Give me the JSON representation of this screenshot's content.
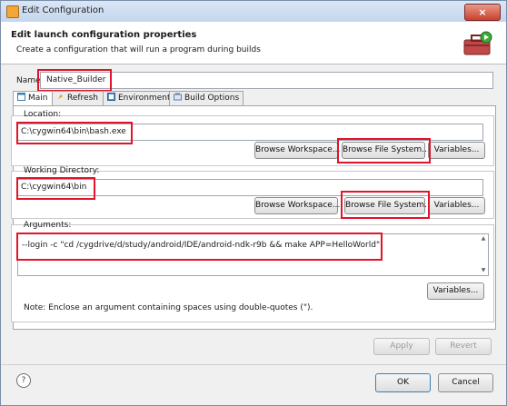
{
  "window": {
    "title": "Edit Configuration",
    "close_label": "×"
  },
  "header": {
    "title": "Edit launch configuration properties",
    "description": "Create a configuration that will run a program during builds"
  },
  "name": {
    "label": "Name:",
    "value": "Native_Builder"
  },
  "tabs": [
    {
      "label": "Main",
      "icon": "main-tab-icon",
      "active": true
    },
    {
      "label": "Refresh",
      "icon": "refresh-icon"
    },
    {
      "label": "Environment",
      "icon": "environment-icon"
    },
    {
      "label": "Build Options",
      "icon": "build-options-icon"
    }
  ],
  "location": {
    "label": "Location:",
    "value": "C:\\cygwin64\\bin\\bash.exe",
    "browse_workspace": "Browse Workspace...",
    "browse_file_system": "Browse File System...",
    "variables": "Variables..."
  },
  "working_directory": {
    "label": "Working Directory:",
    "value": "C:\\cygwin64\\bin",
    "browse_workspace": "Browse Workspace...",
    "browse_file_system": "Browse File System...",
    "variables": "Variables..."
  },
  "arguments": {
    "label": "Arguments:",
    "value": "--login -c  \"cd /cygdrive/d/study/android/IDE/android-ndk-r9b && make APP=HelloWorld\"",
    "variables": "Variables..."
  },
  "note": "Note: Enclose an argument containing spaces using double-quotes (\").",
  "panel_buttons": {
    "apply": "Apply",
    "revert": "Revert"
  },
  "dialog_buttons": {
    "ok": "OK",
    "cancel": "Cancel",
    "help": "?"
  },
  "colors": {
    "highlight": "#e0142a",
    "accent": "#3c7fb1"
  }
}
